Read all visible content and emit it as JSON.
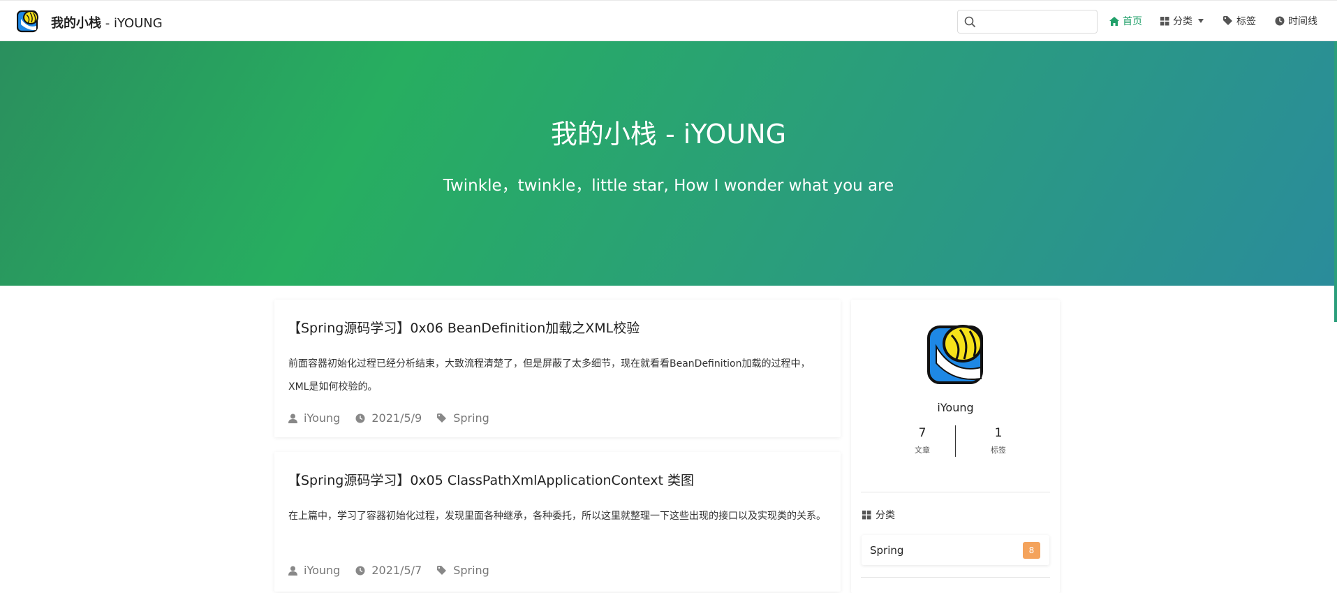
{
  "brand": {
    "title_cn": "我的小栈",
    "title_sep": " - iYOUNG"
  },
  "search": {
    "placeholder": ""
  },
  "nav": {
    "home": "首页",
    "categories": "分类",
    "tags": "标签",
    "timeline": "时间线"
  },
  "hero": {
    "title": "我的小栈 - iYOUNG",
    "subtitle": "Twinkle，twinkle，little star, How I wonder what you are"
  },
  "posts": [
    {
      "title": "【Spring源码学习】0x06 BeanDefinition加载之XML校验",
      "excerpt": "前面容器初始化过程已经分析结束，大致流程清楚了，但是屏蔽了太多细节，现在就看看BeanDefinition加载的过程中，XML是如何校验的。",
      "author": "iYoung",
      "date": "2021/5/9",
      "tag": "Spring"
    },
    {
      "title": "【Spring源码学习】0x05 ClassPathXmlApplicationContext 类图",
      "excerpt": "在上篇中，学习了容器初始化过程，发现里面各种继承，各种委托，所以这里就整理一下这些出现的接口以及实现类的关系。",
      "author": "iYoung",
      "date": "2021/5/7",
      "tag": "Spring"
    }
  ],
  "sidebar": {
    "name": "iYoung",
    "stats": [
      {
        "num": "7",
        "label": "文章"
      },
      {
        "num": "1",
        "label": "标签"
      }
    ],
    "section_title": "分类",
    "categories": [
      {
        "name": "Spring",
        "count": "8"
      }
    ]
  },
  "colors": {
    "accent": "#21a06a",
    "hero_start": "#2a8f5e",
    "hero_mid": "#27ae60",
    "hero_end": "#2a8c9b",
    "badge": "#f4a35c"
  }
}
